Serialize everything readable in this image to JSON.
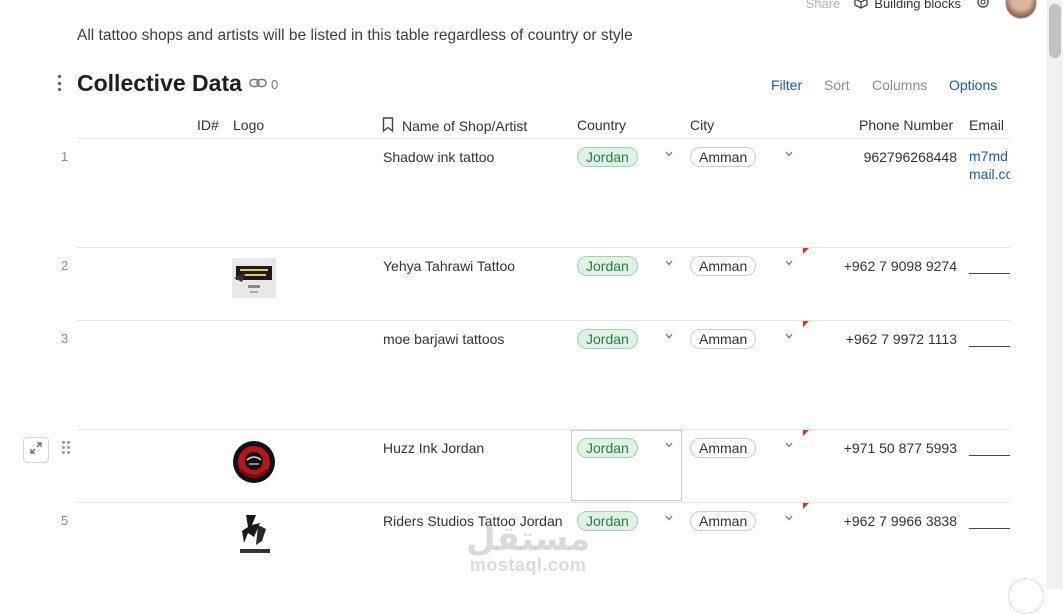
{
  "topbar": {
    "share_label": "Share",
    "building_blocks_label": "Building blocks",
    "icons": [
      "cube-icon",
      "gear-icon",
      "avatar"
    ]
  },
  "description": "All tattoo shops and artists will be listed in this table regardless of country or style",
  "table_title": "Collective Data",
  "link_count": "0",
  "toolbar": {
    "filter": "Filter",
    "sort": "Sort",
    "columns": "Columns",
    "options": "Options"
  },
  "columns": {
    "id": "ID#",
    "logo": "Logo",
    "name": "Name of Shop/Artist",
    "country": "Country",
    "city": "City",
    "phone": "Phone Number",
    "email": "Email"
  },
  "rows": [
    {
      "num": "1",
      "name": "Shadow ink tattoo",
      "country": "Jordan",
      "city": "Amman",
      "phone": "962796268448",
      "email_line1": "m7md",
      "email_line2": "mail.cc"
    },
    {
      "num": "2",
      "name": "Yehya Tahrawi Tattoo",
      "country": "Jordan",
      "city": "Amman",
      "phone": "+962 7 9098 9274",
      "email": "______"
    },
    {
      "num": "3",
      "name": "moe barjawi tattoos",
      "country": "Jordan",
      "city": "Amman",
      "phone": "+962 7 9972 1113",
      "email": "______"
    },
    {
      "num": "",
      "name": "Huzz Ink Jordan",
      "country": "Jordan",
      "city": "Amman",
      "phone": "+971 50 877 5993",
      "email": "______"
    },
    {
      "num": "5",
      "name": "Riders Studios Tattoo Jordan",
      "country": "Jordan",
      "city": "Amman",
      "phone": "+962 7 9966 3838",
      "email": "______"
    }
  ],
  "watermark": {
    "arabic": "مستقل",
    "latin": "mostaql.com"
  },
  "colors": {
    "accent": "#1b5aa6",
    "country_pill_bg": "#dff3e4",
    "country_pill_text": "#2f7a46",
    "flag": "#e0301e"
  }
}
